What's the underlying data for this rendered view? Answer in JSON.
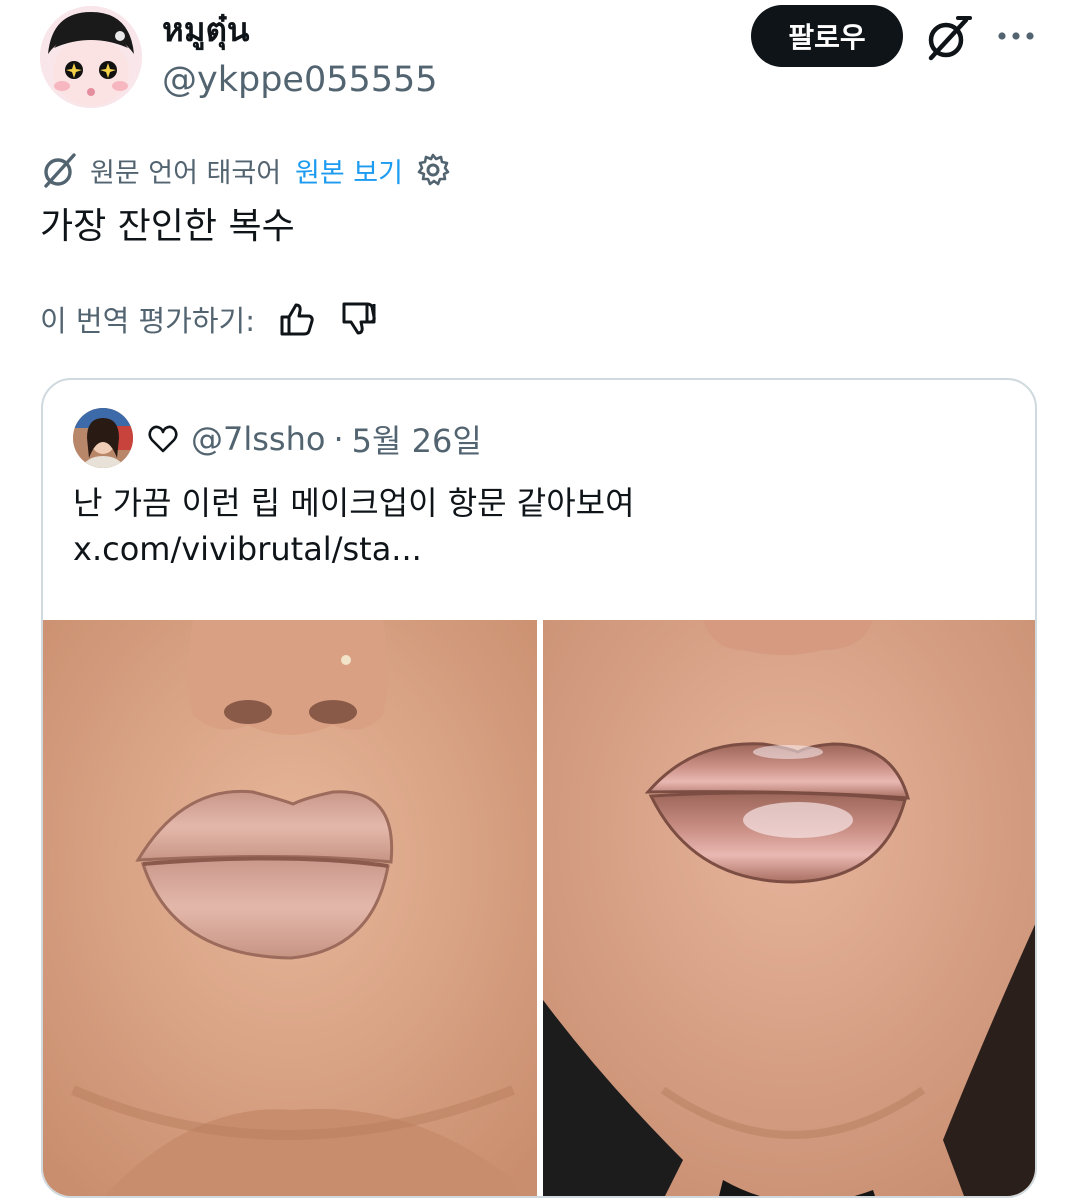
{
  "author": {
    "display_name": "หมูตุ๋น",
    "handle": "@ykppe055555",
    "avatar_icon": "anime-avatar-icon"
  },
  "header": {
    "follow_label": "팔로우",
    "grok_icon": "grok-icon",
    "more_icon": "more-dots-icon"
  },
  "translation": {
    "original_language": "원문 언어 태국어",
    "view_original": "원본 보기",
    "settings_icon": "gear-icon",
    "text": "가장 잔인한 복수",
    "rate_label": "이 번역 평가하기:",
    "thumbs_up_icon": "thumbs-up-icon",
    "thumbs_down_icon": "thumbs-down-icon"
  },
  "quote": {
    "handle": "@7lssho",
    "separator": "·",
    "date": "5월 26일",
    "heart_icon": "heart-icon",
    "text_line1": "난 가끔 이런 립 메이크업이 항문 같아보여",
    "text_line2": "x.com/vivibrutal/sta...",
    "photos": [
      "lips-photo-left",
      "lips-photo-right"
    ]
  },
  "colors": {
    "text_primary": "#0f1419",
    "text_secondary": "#536471",
    "link_blue": "#1d9bf0",
    "border": "#cfd9de",
    "button_dark": "#0f1419"
  }
}
